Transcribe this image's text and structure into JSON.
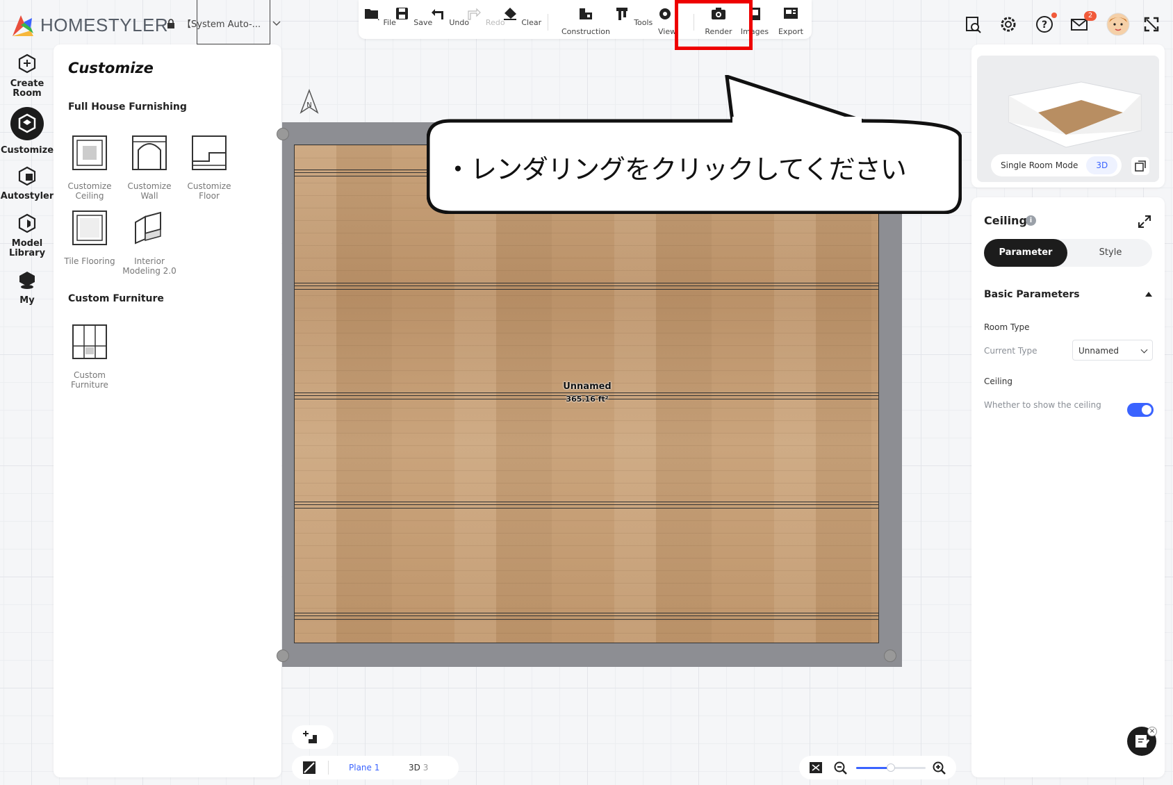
{
  "brand": {
    "name": "HOMESTYLER",
    "colors": [
      "#e84e3c",
      "#f6b73c",
      "#39b54a",
      "#3a63ff"
    ]
  },
  "project": {
    "name": "【System Auto-..."
  },
  "toolbar": {
    "items": [
      {
        "label": "File",
        "icon": "folder-icon"
      },
      {
        "label": "Save",
        "icon": "save-icon"
      },
      {
        "label": "Undo",
        "icon": "undo-icon"
      },
      {
        "label": "Redo",
        "icon": "redo-icon",
        "disabled": true
      },
      {
        "label": "Clear",
        "icon": "eraser-icon"
      },
      {
        "label": "Construction",
        "icon": "construction-icon"
      },
      {
        "label": "Tools",
        "icon": "tools-icon"
      },
      {
        "label": "View",
        "icon": "eye-icon"
      },
      {
        "label": "Render",
        "icon": "camera-icon"
      },
      {
        "label": "Images",
        "icon": "images-icon"
      },
      {
        "label": "Export",
        "icon": "export-icon"
      }
    ]
  },
  "header_right": {
    "mail_count": "2",
    "icons": [
      "catalog-search-icon",
      "settings-gear-icon",
      "help-icon",
      "mail-icon",
      "user-avatar",
      "fullscreen-icon"
    ]
  },
  "rail": {
    "items": [
      {
        "label_1": "Create",
        "label_2": "Room",
        "icon": "create-room-icon"
      },
      {
        "label_1": "Customize",
        "label_2": "",
        "icon": "customize-icon",
        "active": true
      },
      {
        "label_1": "Autostyler",
        "label_2": "",
        "icon": "autostyler-icon"
      },
      {
        "label_1": "Model",
        "label_2": "Library",
        "icon": "model-library-icon"
      },
      {
        "label_1": "My",
        "label_2": "",
        "icon": "my-icon"
      }
    ]
  },
  "panel": {
    "title": "Customize",
    "section_1": "Full House Furnishing",
    "tiles_1": [
      {
        "label_1": "Customize",
        "label_2": "Ceiling"
      },
      {
        "label_1": "Customize",
        "label_2": "Wall"
      },
      {
        "label_1": "Customize",
        "label_2": "Floor"
      },
      {
        "label_1": "Tile Flooring",
        "label_2": ""
      },
      {
        "label_1": "Interior",
        "label_2": "Modeling 2.0"
      }
    ],
    "section_2": "Custom Furniture",
    "tiles_2": [
      {
        "label_1": "Custom",
        "label_2": "Furniture"
      }
    ]
  },
  "canvas": {
    "room_name": "Unnamed",
    "room_area": "365.16 ft²",
    "compass_label": "N",
    "floor_color": "#c9a47a",
    "wall_color": "#8d8e93"
  },
  "callout": {
    "text": "・レンダリングをクリックしてください",
    "highlight_color": "#ee0000"
  },
  "preview": {
    "mode_label": "Single Room Mode",
    "view_label": "3D"
  },
  "properties": {
    "title": "Ceiling",
    "tabs": [
      {
        "label": "Parameter",
        "active": true
      },
      {
        "label": "Style"
      }
    ],
    "basic_title": "Basic Parameters",
    "room_type_label": "Room Type",
    "current_type_label": "Current Type",
    "current_type_value": "Unnamed",
    "ceiling_label": "Ceiling",
    "show_ceiling_label": "Whether to show the ceiling",
    "show_ceiling": true,
    "accent": "#3a63ff"
  },
  "bottom": {
    "plane_label": "Plane",
    "plane_key": "1",
    "threed_label": "3D",
    "threed_key": "3",
    "zoom_level": 0.5
  }
}
